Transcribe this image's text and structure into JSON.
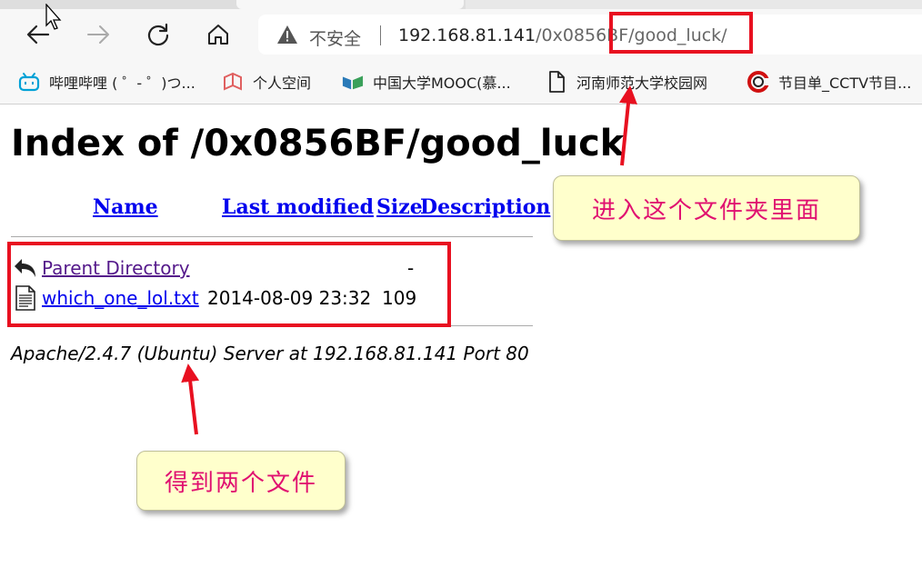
{
  "browser": {
    "security_label": "不安全",
    "url_host": "192.168.81.141",
    "url_path": "/0x0856BF/good_luck/",
    "nav_icons": [
      "back-icon",
      "forward-icon",
      "reload-icon",
      "home-icon"
    ]
  },
  "bookmarks": [
    {
      "label": "哔哩哔哩 ( ゜- ゜)つ...",
      "icon": "bilibili-icon"
    },
    {
      "label": "个人空间",
      "icon": "space-icon"
    },
    {
      "label": "中国大学MOOC(慕...",
      "icon": "mooc-icon"
    },
    {
      "label": "河南师范大学校园网",
      "icon": "page-icon"
    },
    {
      "label": "节目单_CCTV节目...",
      "icon": "cctv-icon"
    }
  ],
  "listing": {
    "title": "Index of /0x0856BF/good_luck",
    "headers": {
      "name": "Name",
      "modified": "Last modified",
      "size": "Size",
      "description": "Description"
    },
    "rows": [
      {
        "name": "Parent Directory",
        "modified": "",
        "size": "-",
        "icon": "back-folder-icon"
      },
      {
        "name": "which_one_lol.txt",
        "modified": "2014-08-09 23:32",
        "size": "109",
        "icon": "text-file-icon"
      }
    ],
    "footer": "Apache/2.4.7 (Ubuntu) Server at 192.168.81.141 Port 80"
  },
  "annotations": {
    "note_folder": "进入这个文件夹里面",
    "note_files": "得到两个文件",
    "color": "#e81020",
    "note_text_color": "#e01070",
    "note_bg": "#ffffcc"
  }
}
